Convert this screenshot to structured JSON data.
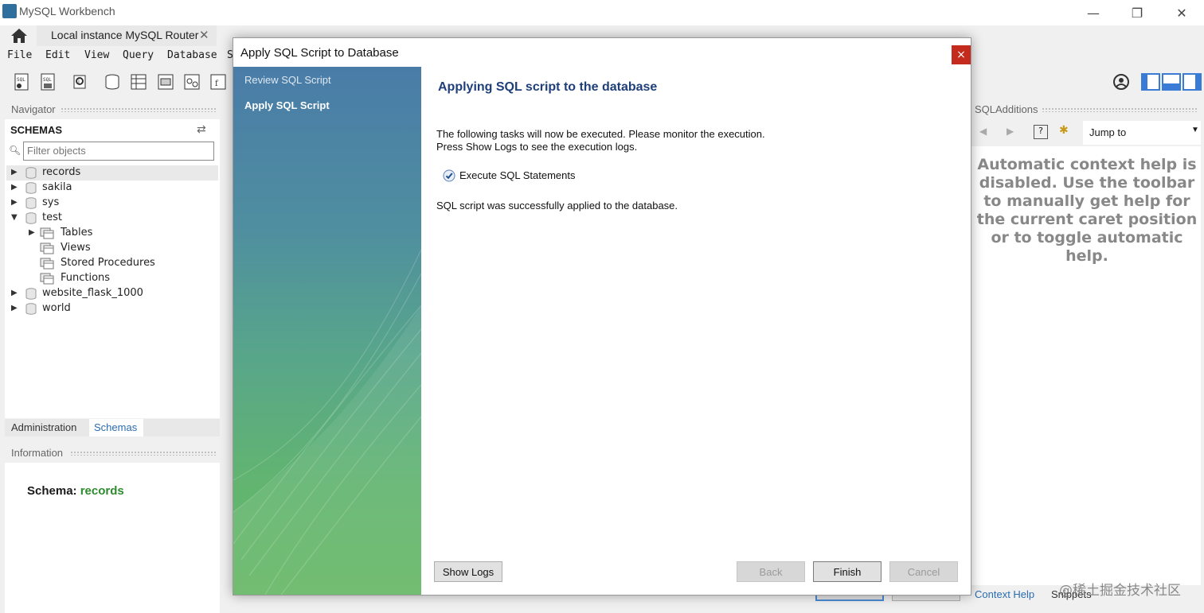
{
  "window": {
    "title": "MySQL Workbench",
    "minimize": "—",
    "restore": "❐",
    "close": "✕"
  },
  "tabs": {
    "home_icon": "home-icon",
    "connection_tab": "Local instance MySQL Router",
    "connection_close": "✕"
  },
  "menu": [
    "File",
    "Edit",
    "View",
    "Query",
    "Database",
    "S"
  ],
  "navigator": {
    "header": "Navigator",
    "schemas_title": "SCHEMAS",
    "filter_placeholder": "Filter objects",
    "tree": [
      {
        "label": "records",
        "type": "schema",
        "expanded": false,
        "selected": true
      },
      {
        "label": "sakila",
        "type": "schema",
        "expanded": false
      },
      {
        "label": "sys",
        "type": "schema",
        "expanded": false
      },
      {
        "label": "test",
        "type": "schema",
        "expanded": true
      },
      {
        "label": "Tables",
        "type": "folder",
        "expanded": false
      },
      {
        "label": "Views",
        "type": "folder"
      },
      {
        "label": "Stored Procedures",
        "type": "folder"
      },
      {
        "label": "Functions",
        "type": "folder"
      },
      {
        "label": "website_flask_1000",
        "type": "schema",
        "expanded": false
      },
      {
        "label": "world",
        "type": "schema",
        "expanded": false
      }
    ],
    "bottom_tabs": [
      "Administration",
      "Schemas"
    ]
  },
  "information": {
    "header": "Information",
    "schema_label": "Schema:",
    "schema_value": "records"
  },
  "sql_additions": {
    "header": "SQLAdditions",
    "jump_to": "Jump to",
    "help_text": "Automatic context help is disabled. Use the toolbar to manually get help for the current caret position or to toggle automatic help.",
    "bottom_tabs": [
      "Context Help",
      "Snippets"
    ]
  },
  "dialog": {
    "title": "Apply SQL Script to Database",
    "close": "×",
    "steps": [
      "Review SQL Script",
      "Apply SQL Script"
    ],
    "heading": "Applying SQL script to the database",
    "instructions_line1": "The following tasks will now be executed. Please monitor the execution.",
    "instructions_line2": "Press Show Logs to see the execution logs.",
    "task": {
      "label": "Execute SQL Statements",
      "done": true
    },
    "result": "SQL script was successfully applied to the database.",
    "buttons": {
      "show_logs": "Show Logs",
      "back": "Back",
      "finish": "Finish",
      "cancel": "Cancel"
    }
  },
  "watermark": "@稀土掘金技术社区",
  "colors": {
    "accent": "#2a6db0",
    "heading": "#1f3f7a",
    "schema_value": "#2e8b2e",
    "close_red": "#c42b1c"
  }
}
